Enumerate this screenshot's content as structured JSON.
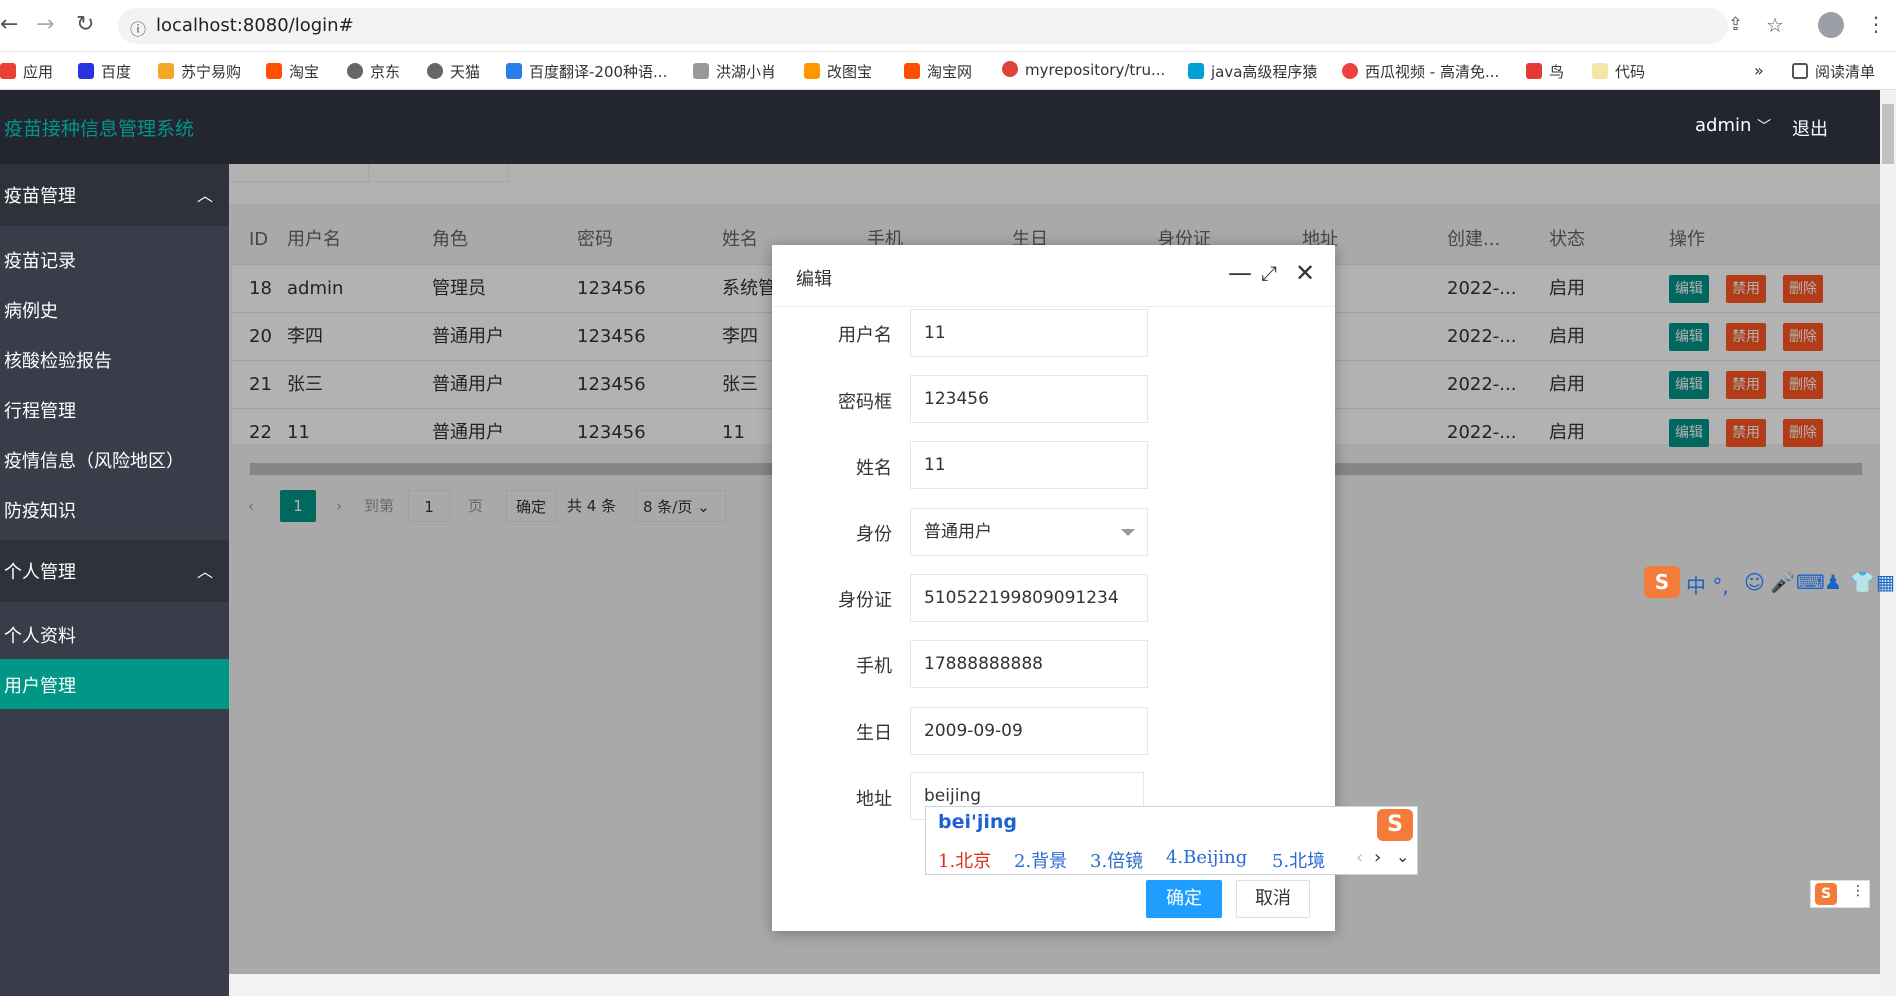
{
  "browser": {
    "url": "localhost:8080/login#",
    "bookmarks": [
      "应用",
      "百度",
      "苏宁易购",
      "淘宝",
      "京东",
      "天猫",
      "百度翻译-200种语...",
      "洪湖小肖",
      "改图宝",
      "淘宝网",
      "myrepository/tru...",
      "java高级程序猿",
      "西瓜视频 - 高清免...",
      "鸟",
      "代码"
    ],
    "reading_list": "阅读清单",
    "overflow": "»"
  },
  "app": {
    "title": "疫苗接种信息管理系统",
    "user": "admin",
    "logout": "退出"
  },
  "sidebar": {
    "groups": [
      {
        "label": "疫苗管理",
        "items": [
          "疫苗记录",
          "病例史",
          "核酸检验报告",
          "行程管理",
          "疫情信息（风险地区）",
          "防疫知识"
        ]
      },
      {
        "label": "个人管理",
        "items": [
          "个人资料",
          "用户管理"
        ]
      }
    ],
    "active": "用户管理"
  },
  "table": {
    "columns": [
      "ID",
      "用户名",
      "角色",
      "密码",
      "姓名",
      "手机",
      "生日",
      "身份证",
      "地址",
      "创建...",
      "状态",
      "操作"
    ],
    "rows": [
      {
        "id": "18",
        "username": "admin",
        "role": "管理员",
        "password": "123456",
        "name": "系统管",
        "created": "2022-...",
        "status": "启用"
      },
      {
        "id": "20",
        "username": "李四",
        "role": "普通用户",
        "password": "123456",
        "name": "李四",
        "created": "2022-...",
        "status": "启用"
      },
      {
        "id": "21",
        "username": "张三",
        "role": "普通用户",
        "password": "123456",
        "name": "张三",
        "created": "2022-...",
        "status": "启用"
      },
      {
        "id": "22",
        "username": "11",
        "role": "普通用户",
        "password": "123456",
        "name": "11",
        "created": "2022-...",
        "status": "启用"
      }
    ],
    "actions": {
      "edit": "编辑",
      "disable": "禁用",
      "delete": "删除"
    }
  },
  "pager": {
    "current": "1",
    "goto_label": "到第",
    "goto_value": "1",
    "page_unit": "页",
    "confirm": "确定",
    "total": "共 4 条",
    "page_size": "8 条/页"
  },
  "dialog": {
    "title": "编辑",
    "fields": [
      {
        "label": "用户名",
        "value": "11"
      },
      {
        "label": "密码框",
        "value": "123456"
      },
      {
        "label": "姓名",
        "value": "11"
      },
      {
        "label": "身份",
        "value": "普通用户"
      },
      {
        "label": "身份证",
        "value": "510522199809091234"
      },
      {
        "label": "手机",
        "value": "17888888888"
      },
      {
        "label": "生日",
        "value": "2009-09-09"
      },
      {
        "label": "地址",
        "value": "beijing"
      }
    ],
    "ok": "确定",
    "cancel": "取消"
  },
  "ime": {
    "pinyin": "bei'jing",
    "candidates": [
      "1.北京",
      "2.背景",
      "3.倍镜",
      "4.Beijing",
      "5.北境"
    ],
    "toolbar": "中 °,"
  },
  "colors": {
    "accent": "#009688",
    "header": "#23262e",
    "sidebar": "#393d49",
    "danger": "#ff5722",
    "primary": "#1e9fff"
  }
}
